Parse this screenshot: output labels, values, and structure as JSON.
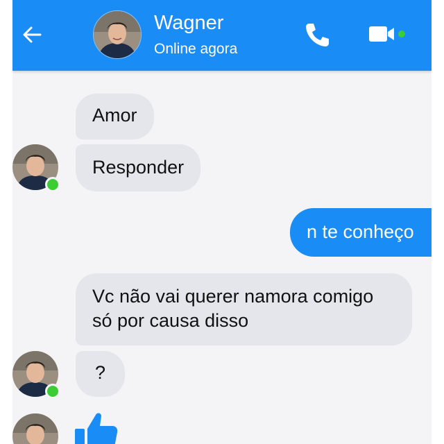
{
  "header": {
    "contact_name": "Wagner",
    "status": "Online agora",
    "icons": [
      "back-arrow-icon",
      "phone-icon",
      "video-camera-icon"
    ],
    "accent_color": "#1a8cf5",
    "online_color": "#3ccd34"
  },
  "messages": [
    {
      "direction": "incoming",
      "text": "Amor"
    },
    {
      "direction": "incoming",
      "text": "Responder"
    },
    {
      "direction": "outgoing",
      "text": "n te conheço"
    },
    {
      "direction": "incoming",
      "text": "Vc não vai querer namora comigo só por causa disso"
    },
    {
      "direction": "incoming",
      "text": "?"
    },
    {
      "direction": "incoming",
      "icon": "thumbs-up-icon"
    }
  ]
}
